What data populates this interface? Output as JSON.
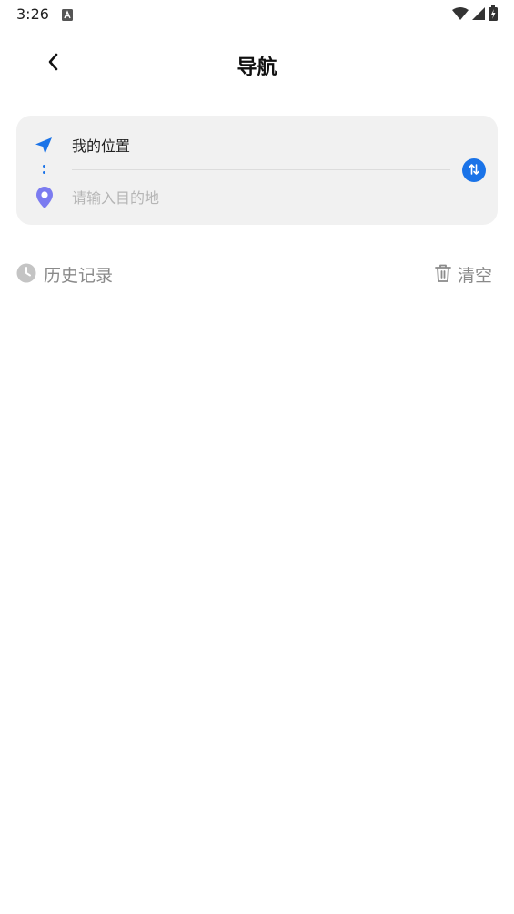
{
  "status_bar": {
    "time": "3:26",
    "icons": [
      "notification-a-icon",
      "wifi-icon",
      "signal-icon",
      "battery-icon"
    ]
  },
  "header": {
    "title": "导航",
    "back_icon": "chevron-left-icon"
  },
  "route": {
    "origin_label": "我的位置",
    "origin_icon": "navigation-arrow-icon",
    "destination_placeholder": "请输入目的地",
    "destination_value": "",
    "destination_icon": "location-pin-icon",
    "swap_icon": "swap-icon"
  },
  "history": {
    "label": "历史记录",
    "icon": "clock-icon",
    "clear_label": "清空",
    "clear_icon": "trash-icon",
    "items": []
  },
  "colors": {
    "accent": "#1a73e8",
    "pin": "#7b7bf0",
    "card_bg": "#f1f1f1",
    "muted_text": "#8a8a8a"
  }
}
